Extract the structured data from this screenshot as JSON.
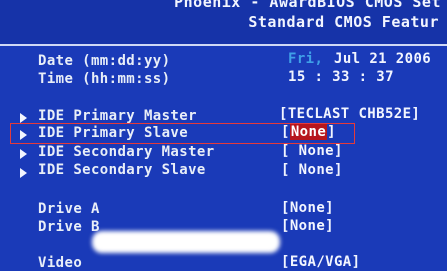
{
  "header": {
    "title_line1": "Phoenix - AwardBIOS CMOS Set",
    "title_line2": "Standard CMOS Featur"
  },
  "date": {
    "label": "Date (mm:dd:yy)",
    "day": "Fri,",
    "value": "Jul 21 2006"
  },
  "time": {
    "label": "Time (hh:mm:ss)",
    "value": "15 : 33 : 37"
  },
  "ide_items": [
    {
      "label": "IDE Primary Master",
      "value": "[TECLAST CHB52E]"
    },
    {
      "label": "IDE Primary Slave",
      "bracket_open": "[",
      "value": "None",
      "bracket_close": "]"
    },
    {
      "label": "IDE Secondary Master",
      "value": "[ None]"
    },
    {
      "label": "IDE Secondary Slave",
      "value": "[ None]"
    }
  ],
  "drives": [
    {
      "label": "Drive A",
      "value": "[None]"
    },
    {
      "label": "Drive B",
      "value": "[None]"
    }
  ],
  "cutoff": {
    "label": "Video",
    "value": "[EGA/VGA]"
  },
  "colors": {
    "background": "#1a3ab8",
    "text": "#e8eef8",
    "day_accent": "#3fa0e8",
    "selection_border": "#e43a3a",
    "highlight": "#b6161d"
  }
}
